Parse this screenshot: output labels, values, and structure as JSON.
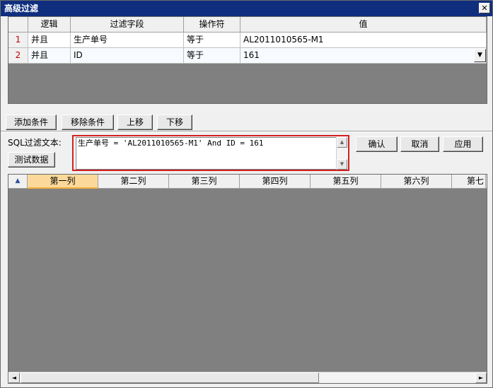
{
  "window": {
    "title": "高级过滤",
    "close_glyph": "✕"
  },
  "filter_grid": {
    "headers": [
      "逻辑",
      "过滤字段",
      "操作符",
      "值"
    ],
    "rows": [
      {
        "num": "1",
        "logic": "并且",
        "field": "生产单号",
        "op": "等于",
        "value": "AL2011010565-M1"
      },
      {
        "num": "2",
        "logic": "并且",
        "field": "ID",
        "op": "等于",
        "value": "161"
      }
    ],
    "dropdown_glyph": "▼"
  },
  "buttons": {
    "add": "添加条件",
    "remove": "移除条件",
    "up": "上移",
    "down": "下移",
    "test": "测试数据",
    "confirm": "确认",
    "cancel": "取消",
    "apply": "应用"
  },
  "sql": {
    "label": "SQL过滤文本:",
    "text": "生产单号 = 'AL2011010565-M1' And ID = 161",
    "highlight_color": "#d21f1f"
  },
  "result_grid": {
    "corner_glyph": "▲",
    "columns": [
      "第一列",
      "第二列",
      "第三列",
      "第四列",
      "第五列",
      "第六列",
      "第七"
    ],
    "active_column": "第一列"
  },
  "scroll": {
    "left_glyph": "◄",
    "right_glyph": "►",
    "up_glyph": "▲",
    "down_glyph": "▼"
  },
  "colors": {
    "titlebar": "#0f2f7e",
    "grid_bg": "#808080",
    "active_header": "#fcd99a"
  }
}
